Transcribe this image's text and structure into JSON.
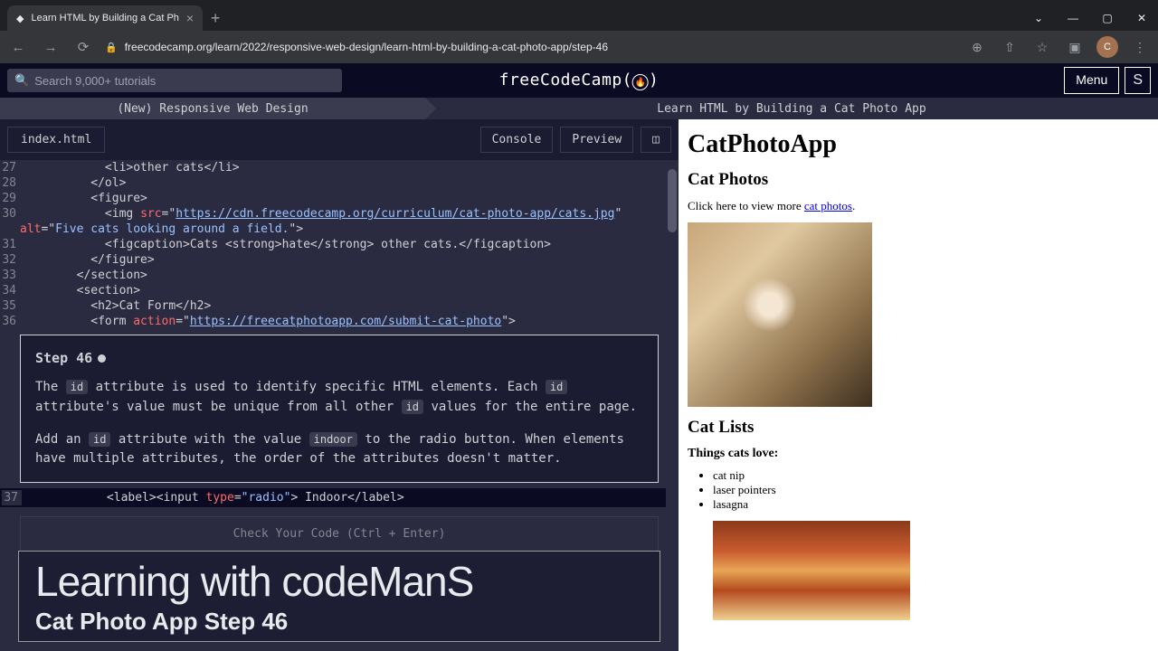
{
  "browser": {
    "tab_title": "Learn HTML by Building a Cat Ph",
    "url": "freecodecamp.org/learn/2022/responsive-web-design/learn-html-by-building-a-cat-photo-app/step-46",
    "avatar_letter": "C"
  },
  "header": {
    "search_placeholder": "Search 9,000+ tutorials",
    "brand": "freeCodeCamp",
    "menu_label": "Menu"
  },
  "crumbs": {
    "left": "(New) Responsive Web Design",
    "right": "Learn HTML by Building a Cat Photo App"
  },
  "tabs": {
    "file": "index.html",
    "console": "Console",
    "preview": "Preview"
  },
  "code": {
    "lines": [
      {
        "n": "27",
        "t": "            <li>other cats</li>"
      },
      {
        "n": "28",
        "t": "          </ol>"
      },
      {
        "n": "29",
        "t": "          <figure>"
      },
      {
        "n": "30",
        "img": true
      },
      {
        "n": "31",
        "fig": true
      },
      {
        "n": "32",
        "t": "          </figure>"
      },
      {
        "n": "33",
        "t": "        </section>"
      },
      {
        "n": "34",
        "t": "        <section>"
      },
      {
        "n": "35",
        "t": "          <h2>Cat Form</h2>"
      },
      {
        "n": "36",
        "form": true
      }
    ],
    "img_src": "https://cdn.freecodecamp.org/curriculum/cat-photo-app/cats.jpg",
    "img_alt": "Five cats looking around a field.",
    "form_action": "https://freecatphotoapp.com/submit-cat-photo",
    "edit_line_n": "37",
    "edit_line": "            <label><input type=\"radio\"> Indoor</label>"
  },
  "instructions": {
    "title": "Step 46",
    "p1a": "The ",
    "p1b": " attribute is used to identify specific HTML elements. Each ",
    "p1c": " attribute's value must be unique from all other ",
    "p1d": " values for the entire page.",
    "p2a": "Add an ",
    "p2b": " attribute with the value ",
    "p2c": " to the radio button. When elements have multiple attributes, the order of the attributes doesn't matter.",
    "code_id": "id",
    "code_indoor": "indoor"
  },
  "check_button": "Check Your Code (Ctrl + Enter)",
  "overlay": {
    "line1": "Learning with codeManS",
    "line2": "Cat Photo App Step 46"
  },
  "preview": {
    "h1": "CatPhotoApp",
    "h2a": "Cat Photos",
    "p1a": "Click here to view more ",
    "p1link": "cat photos",
    "h2b": "Cat Lists",
    "h3a": "Things cats love:",
    "ul": [
      "cat nip",
      "laser pointers",
      "lasagna"
    ]
  }
}
